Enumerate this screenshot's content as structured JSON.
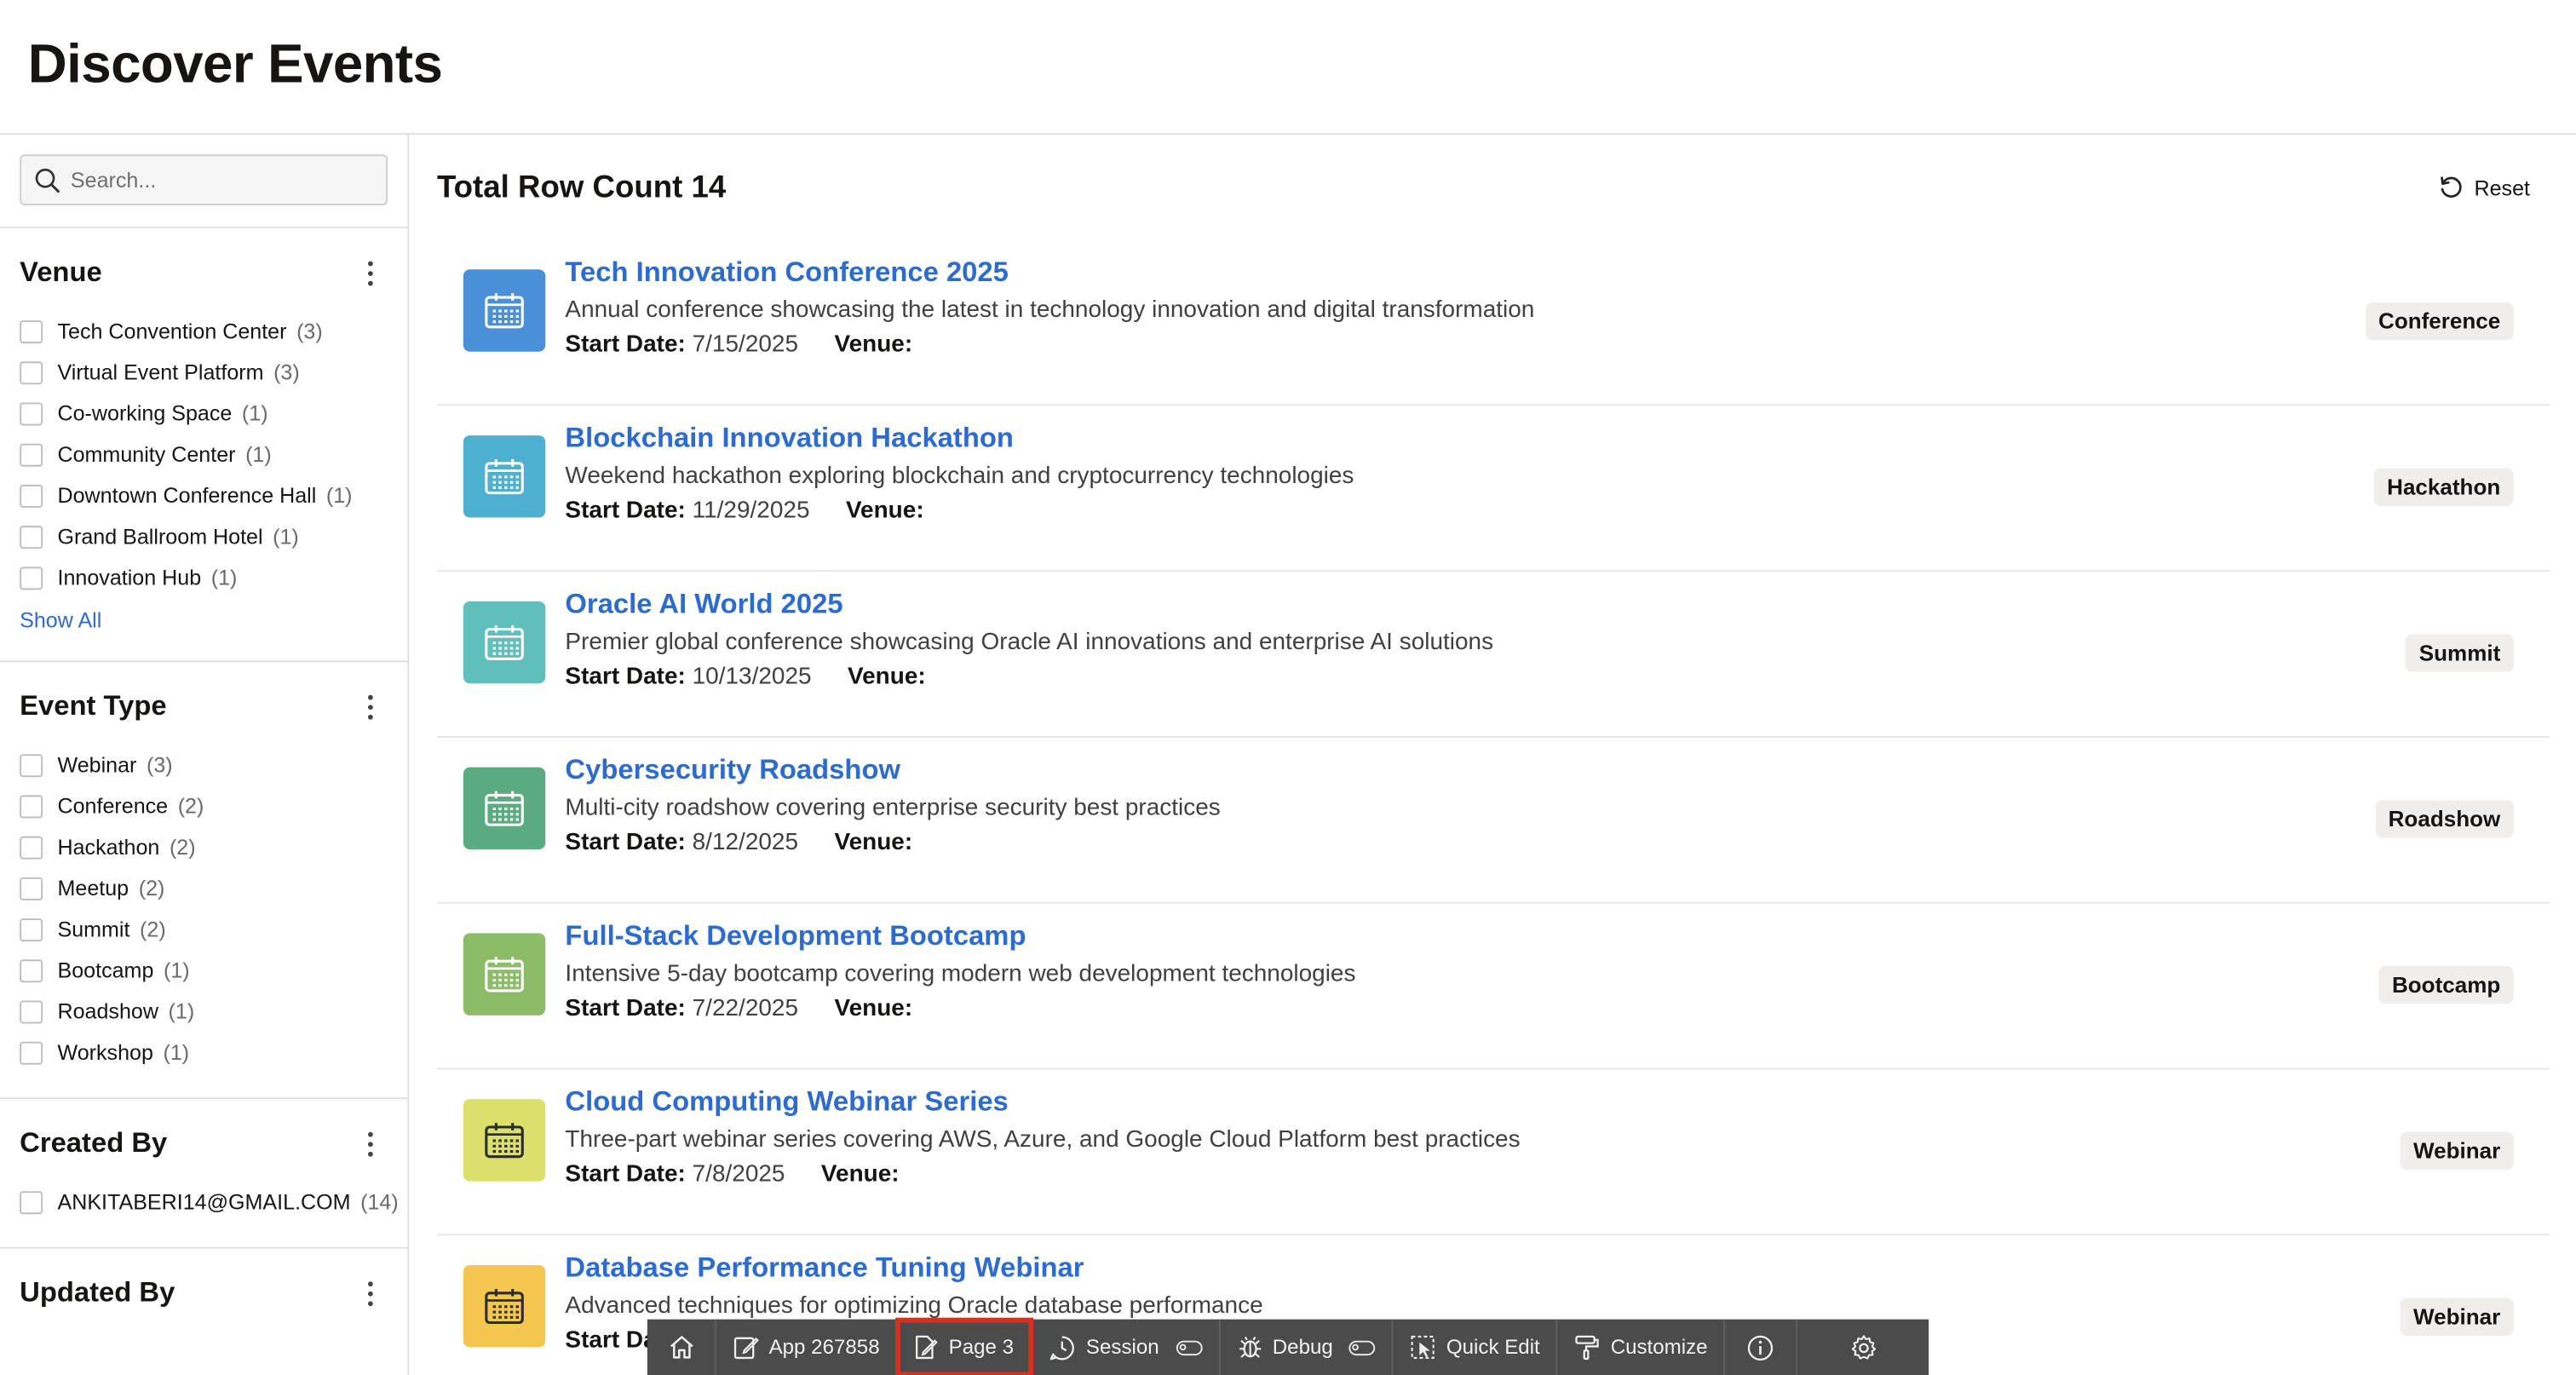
{
  "page": {
    "title": "Discover Events"
  },
  "search": {
    "placeholder": "Search..."
  },
  "facets": {
    "venue": {
      "title": "Venue",
      "show_all": "Show All",
      "options": [
        {
          "label": "Tech Convention Center",
          "count": "(3)"
        },
        {
          "label": "Virtual Event Platform",
          "count": "(3)"
        },
        {
          "label": "Co-working Space",
          "count": "(1)"
        },
        {
          "label": "Community Center",
          "count": "(1)"
        },
        {
          "label": "Downtown Conference Hall",
          "count": "(1)"
        },
        {
          "label": "Grand Ballroom Hotel",
          "count": "(1)"
        },
        {
          "label": "Innovation Hub",
          "count": "(1)"
        }
      ]
    },
    "event_type": {
      "title": "Event Type",
      "options": [
        {
          "label": "Webinar",
          "count": "(3)"
        },
        {
          "label": "Conference",
          "count": "(2)"
        },
        {
          "label": "Hackathon",
          "count": "(2)"
        },
        {
          "label": "Meetup",
          "count": "(2)"
        },
        {
          "label": "Summit",
          "count": "(2)"
        },
        {
          "label": "Bootcamp",
          "count": "(1)"
        },
        {
          "label": "Roadshow",
          "count": "(1)"
        },
        {
          "label": "Workshop",
          "count": "(1)"
        }
      ]
    },
    "created_by": {
      "title": "Created By",
      "options": [
        {
          "label": "ANKITABERI14@GMAIL.COM",
          "count": "(14)"
        }
      ]
    },
    "updated_by": {
      "title": "Updated By"
    }
  },
  "results": {
    "row_count_label": "Total Row Count 14",
    "reset_label": "Reset",
    "start_date_label": "Start Date:",
    "venue_label": "Venue:",
    "items": [
      {
        "title": "Tech Innovation Conference 2025",
        "description": "Annual conference showcasing the latest in technology innovation and digital transformation",
        "start_date": "7/15/2025",
        "badge": "Conference",
        "icon_color": "#4a90d6",
        "icon_stroke": "#ffffff"
      },
      {
        "title": "Blockchain Innovation Hackathon",
        "description": "Weekend hackathon exploring blockchain and cryptocurrency technologies",
        "start_date": "11/29/2025",
        "badge": "Hackathon",
        "icon_color": "#4db0cf",
        "icon_stroke": "#ffffff"
      },
      {
        "title": "Oracle AI World 2025",
        "description": "Premier global conference showcasing Oracle AI innovations and enterprise AI solutions",
        "start_date": "10/13/2025",
        "badge": "Summit",
        "icon_color": "#5ebfbb",
        "icon_stroke": "#ffffff"
      },
      {
        "title": "Cybersecurity Roadshow",
        "description": "Multi-city roadshow covering enterprise security best practices",
        "start_date": "8/12/2025",
        "badge": "Roadshow",
        "icon_color": "#5aab7f",
        "icon_stroke": "#ffffff"
      },
      {
        "title": "Full-Stack Development Bootcamp",
        "description": "Intensive 5-day bootcamp covering modern web development technologies",
        "start_date": "7/22/2025",
        "badge": "Bootcamp",
        "icon_color": "#8cbc68",
        "icon_stroke": "#ffffff"
      },
      {
        "title": "Cloud Computing Webinar Series",
        "description": "Three-part webinar series covering AWS, Azure, and Google Cloud Platform best practices",
        "start_date": "7/8/2025",
        "badge": "Webinar",
        "icon_color": "#dbe06a",
        "icon_stroke": "#2b2b2b"
      },
      {
        "title": "Database Performance Tuning Webinar",
        "description": "Advanced techniques for optimizing Oracle database performance",
        "start_date": "",
        "badge": "Webinar",
        "icon_color": "#f3c74f",
        "icon_stroke": "#2b2b2b"
      }
    ]
  },
  "devbar": {
    "app_label": "App 267858",
    "page_label": "Page 3",
    "session_label": "Session",
    "debug_label": "Debug",
    "quick_edit_label": "Quick Edit",
    "customize_label": "Customize"
  }
}
